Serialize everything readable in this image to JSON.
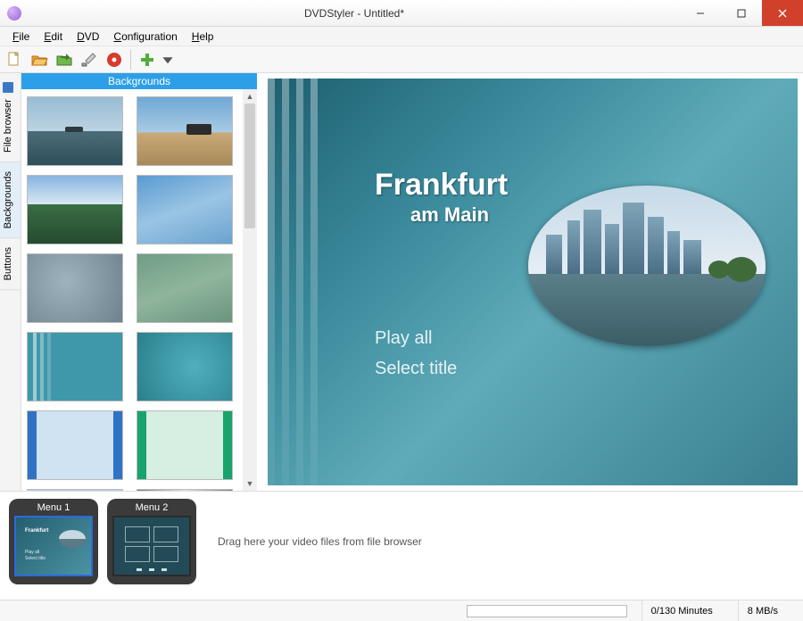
{
  "window": {
    "title": "DVDStyler - Untitled*"
  },
  "menu": {
    "file": "File",
    "edit": "Edit",
    "dvd": "DVD",
    "config": "Configuration",
    "help": "Help"
  },
  "sidetabs": {
    "file_browser": "File browser",
    "backgrounds": "Backgrounds",
    "buttons": "Buttons"
  },
  "panel": {
    "header": "Backgrounds"
  },
  "preview": {
    "title1": "Frankfurt",
    "title2": "am Main",
    "play_all": "Play all",
    "select_title": "Select title"
  },
  "bottom": {
    "menu1": "Menu 1",
    "menu2": "Menu 2",
    "drop_hint": "Drag here your video files from file browser"
  },
  "status": {
    "minutes": "0/130 Minutes",
    "speed": "8 MB/s"
  }
}
